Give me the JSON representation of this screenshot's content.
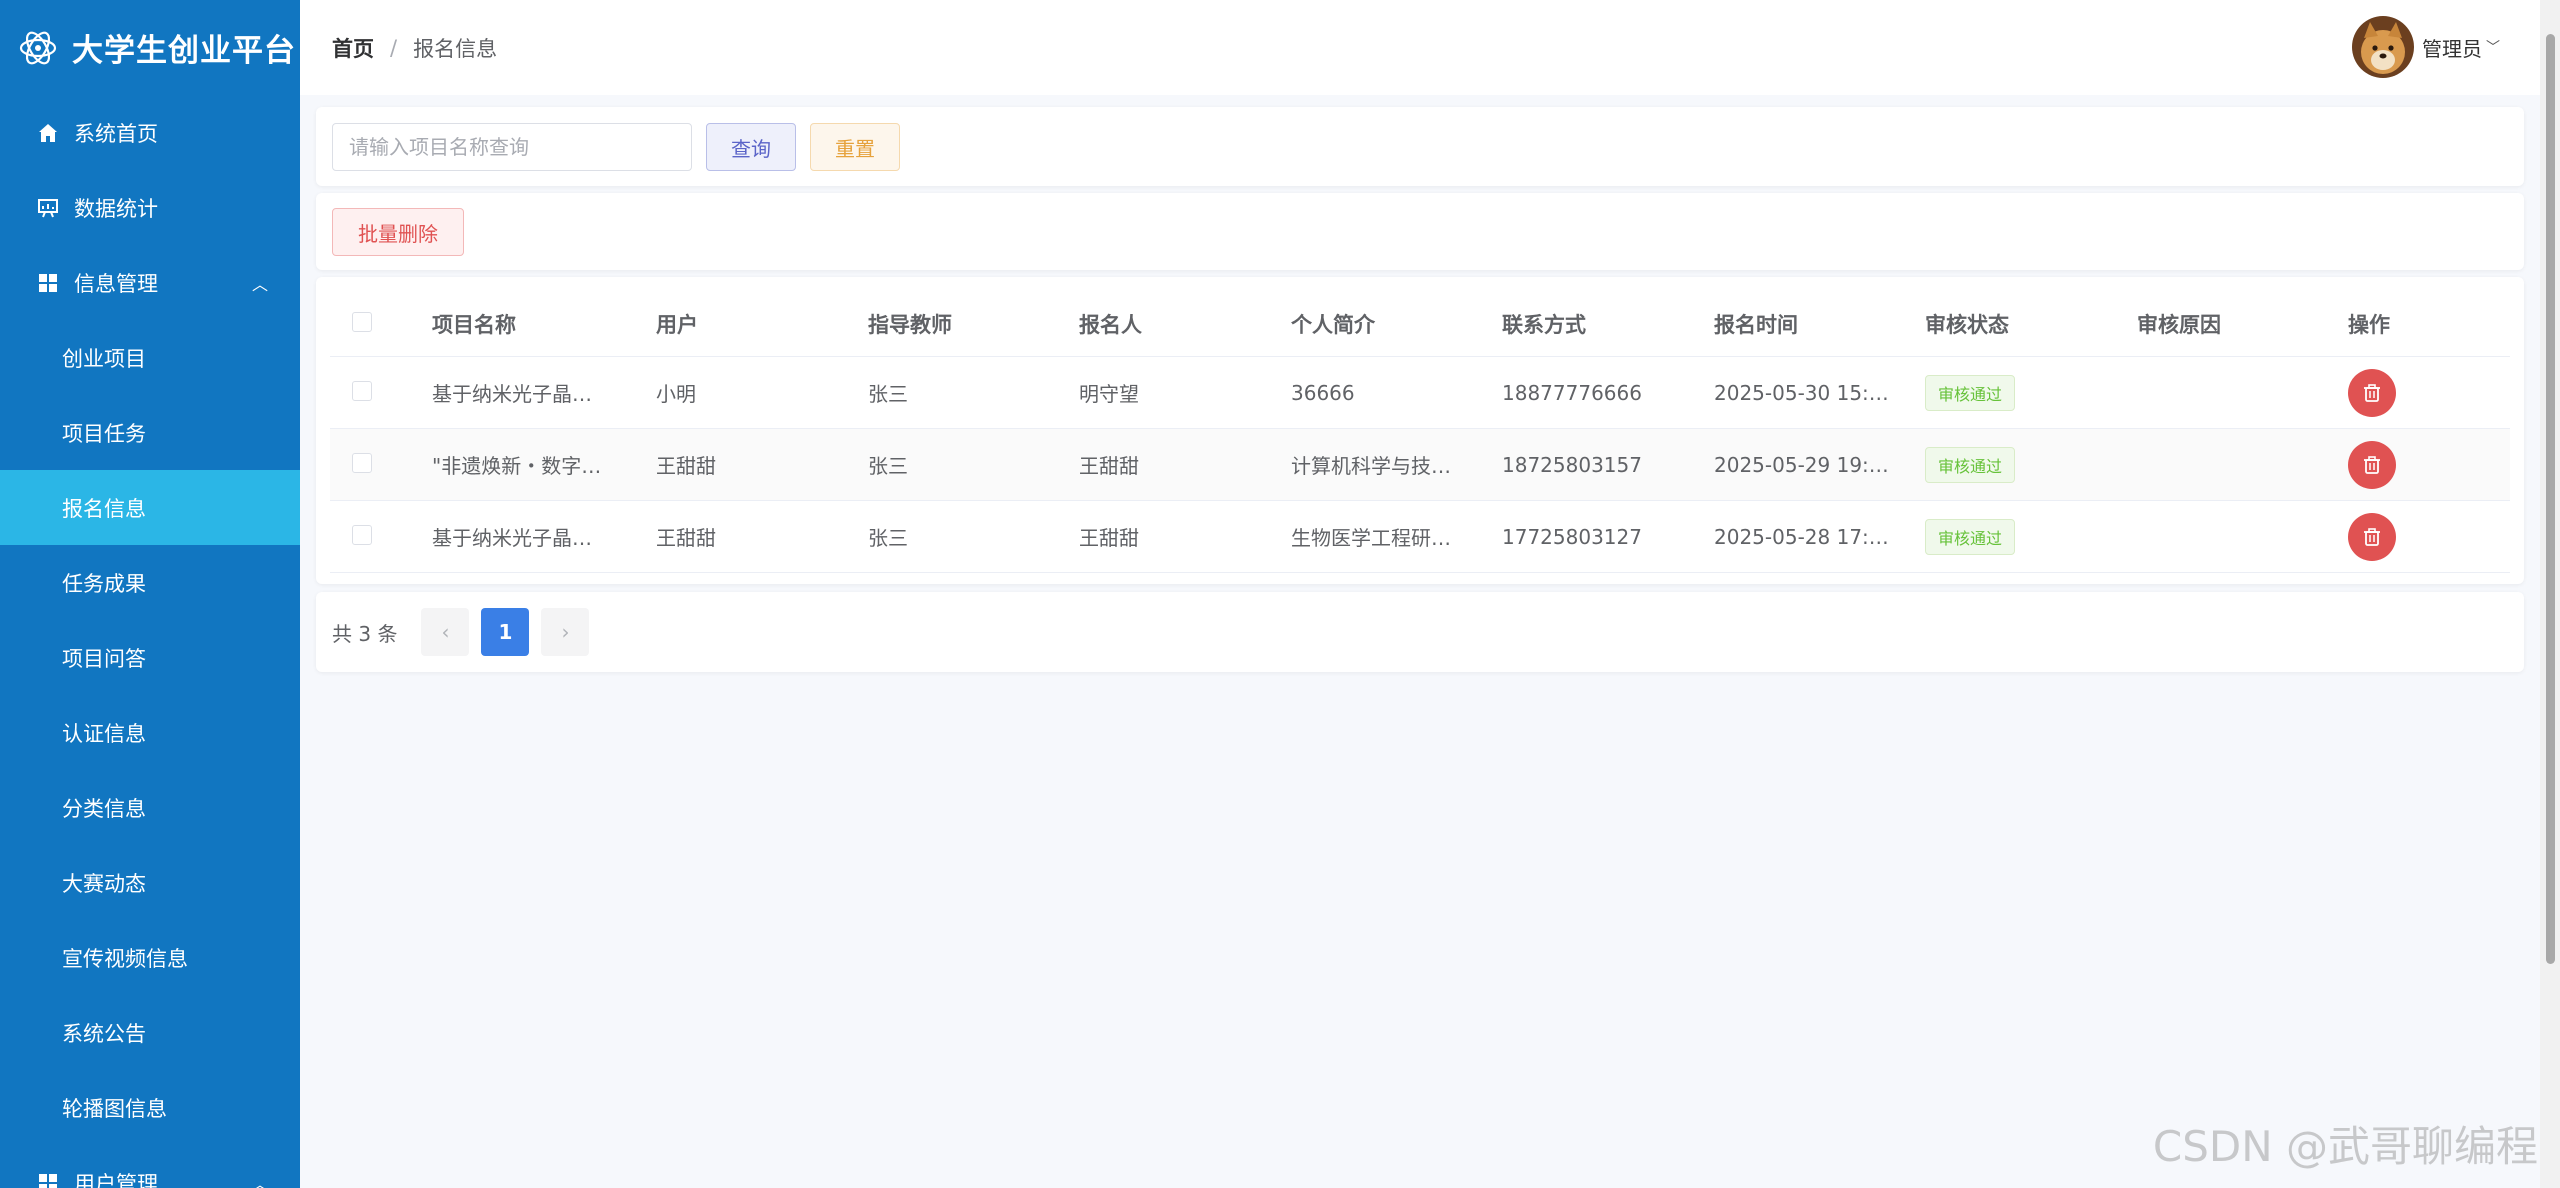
{
  "app": {
    "title": "大学生创业平台"
  },
  "sidebar": {
    "items": [
      {
        "label": "系统首页",
        "icon": "home-icon"
      },
      {
        "label": "数据统计",
        "icon": "chart-icon"
      },
      {
        "label": "信息管理",
        "icon": "grid-icon",
        "expanded": true
      }
    ],
    "sub_items": [
      {
        "label": "创业项目"
      },
      {
        "label": "项目任务"
      },
      {
        "label": "报名信息",
        "active": true
      },
      {
        "label": "任务成果"
      },
      {
        "label": "项目问答"
      },
      {
        "label": "认证信息"
      },
      {
        "label": "分类信息"
      },
      {
        "label": "大赛动态"
      },
      {
        "label": "宣传视频信息"
      },
      {
        "label": "系统公告"
      },
      {
        "label": "轮播图信息"
      }
    ],
    "user_group": {
      "label": "用户管理",
      "icon": "grid-icon"
    },
    "colors": {
      "background": "#1176c1",
      "active": "#2bb6e6"
    }
  },
  "header": {
    "breadcrumb": {
      "home": "首页",
      "separator": "/",
      "current": "报名信息"
    },
    "user": {
      "name": "管理员"
    }
  },
  "search": {
    "placeholder": "请输入项目名称查询",
    "value": "",
    "query_label": "查询",
    "reset_label": "重置"
  },
  "actions": {
    "batch_delete_label": "批量删除"
  },
  "table": {
    "columns": [
      "项目名称",
      "用户",
      "指导教师",
      "报名人",
      "个人简介",
      "联系方式",
      "报名时间",
      "审核状态",
      "审核原因",
      "操作"
    ],
    "rows": [
      {
        "project": "基于纳米光子晶…",
        "user": "小明",
        "teacher": "张三",
        "applicant": "明守望",
        "intro": "36666",
        "phone": "18877776666",
        "time": "2025-05-30 15:…",
        "status": "审核通过",
        "reason": ""
      },
      {
        "project": "\"非遗焕新・数字…",
        "user": "王甜甜",
        "teacher": "张三",
        "applicant": "王甜甜",
        "intro": "计算机科学与技…",
        "phone": "18725803157",
        "time": "2025-05-29 19:…",
        "status": "审核通过",
        "reason": ""
      },
      {
        "project": "基于纳米光子晶…",
        "user": "王甜甜",
        "teacher": "张三",
        "applicant": "王甜甜",
        "intro": "生物医学工程研…",
        "phone": "17725803127",
        "time": "2025-05-28 17:…",
        "status": "审核通过",
        "reason": ""
      }
    ]
  },
  "pagination": {
    "total_label": "共 3 条",
    "pages": [
      "1"
    ],
    "current": "1",
    "prev": "‹",
    "next": "›"
  },
  "watermark": "CSDN @武哥聊编程"
}
